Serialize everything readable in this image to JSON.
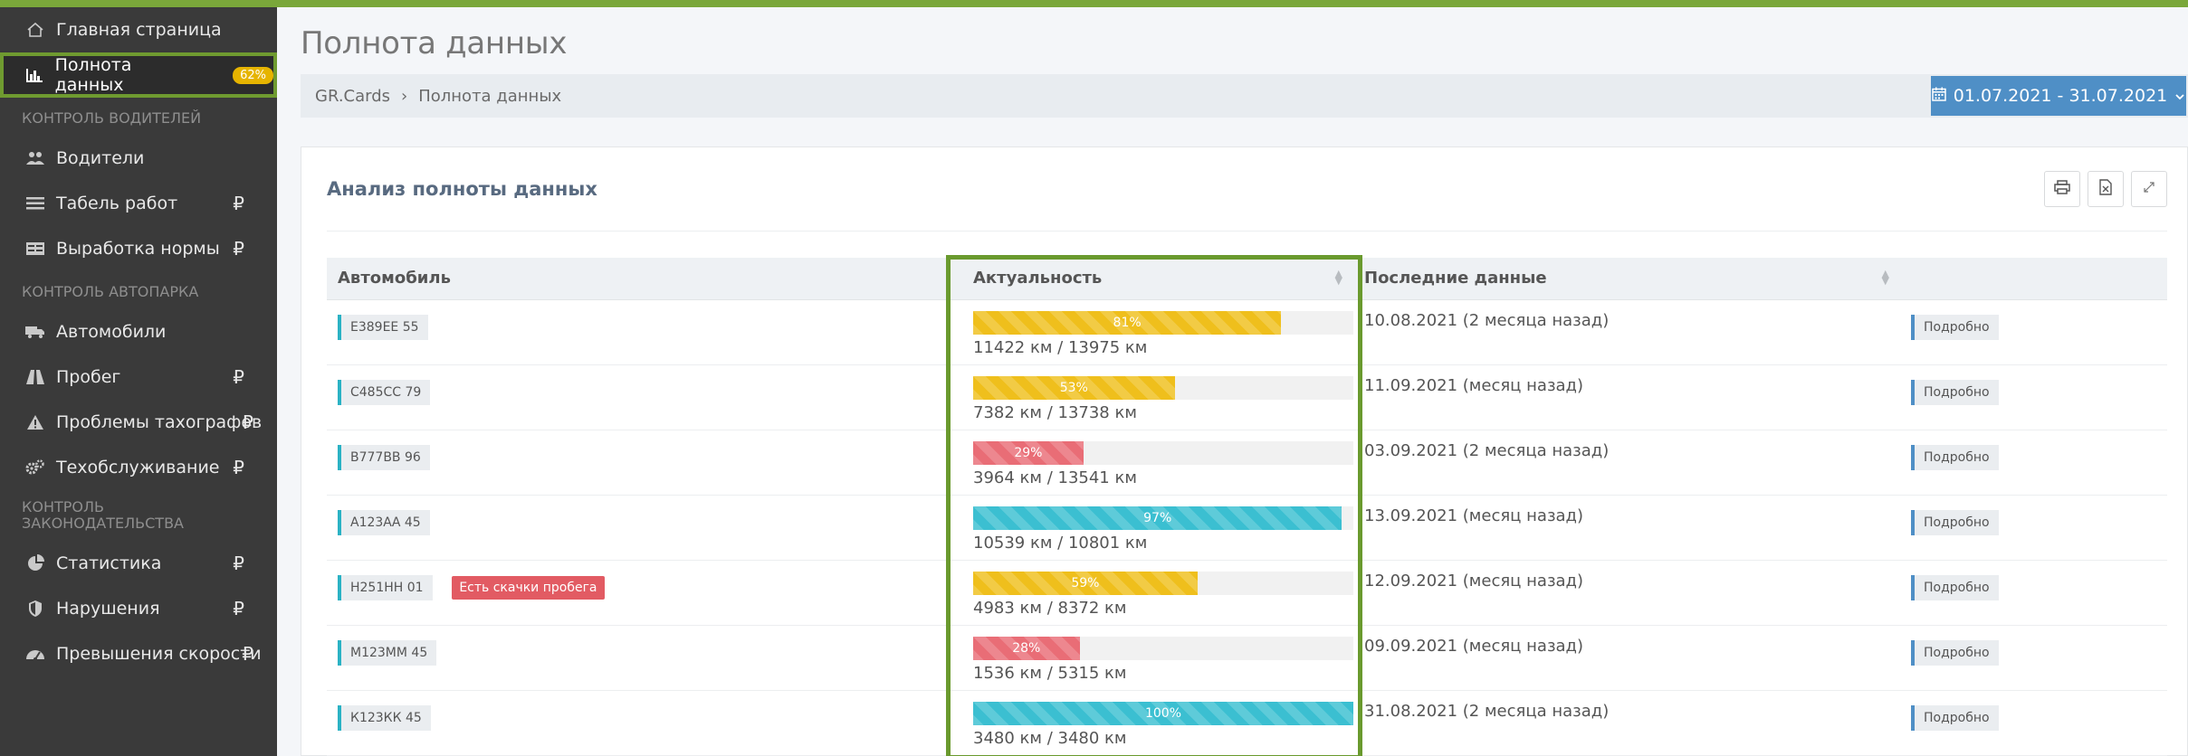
{
  "sidebar": {
    "items": [
      {
        "label": "Главная страница",
        "icon": "home-icon"
      },
      {
        "label": "Полнота данных",
        "icon": "bar-chart-icon",
        "badge": "62%"
      },
      {
        "section": "КОНТРОЛЬ ВОДИТЕЛЕЙ"
      },
      {
        "label": "Водители",
        "icon": "users-icon"
      },
      {
        "label": "Табель работ",
        "icon": "list-icon",
        "rub": "₽"
      },
      {
        "label": "Выработка нормы",
        "icon": "table-icon",
        "rub": "₽"
      },
      {
        "section": "КОНТРОЛЬ АВТОПАРКА"
      },
      {
        "label": "Автомобили",
        "icon": "truck-icon"
      },
      {
        "label": "Пробег",
        "icon": "road-icon",
        "rub": "₽"
      },
      {
        "label": "Проблемы тахографов",
        "icon": "warning-icon",
        "rub": "₽"
      },
      {
        "label": "Техобслуживание",
        "icon": "cogs-icon",
        "rub": "₽"
      },
      {
        "section": "КОНТРОЛЬ ЗАКОНОДАТЕЛЬСТВА"
      },
      {
        "label": "Статистика",
        "icon": "pie-chart-icon",
        "rub": "₽"
      },
      {
        "label": "Нарушения",
        "icon": "shield-icon",
        "rub": "₽"
      },
      {
        "label": "Превышения скорости",
        "icon": "speedometer-icon",
        "rub": "₽"
      }
    ]
  },
  "header": {
    "title": "Полнота данных",
    "breadcrumb": [
      "GR.Cards",
      "›",
      "Полнота данных"
    ],
    "date_range": "01.07.2021 - 31.07.2021"
  },
  "panel": {
    "title": "Анализ полноты данных",
    "tools": [
      "print-icon",
      "excel-icon",
      "expand-icon"
    ]
  },
  "table": {
    "headers": [
      "Автомобиль",
      "Актуальность",
      "Последние данные",
      ""
    ],
    "detail_label": "Подробно",
    "rows": [
      {
        "plate": "Е389ЕЕ 55",
        "tag": "",
        "pct_label": "81%",
        "pct": 81,
        "color": "yellow",
        "km": "11422 км / 13975 км",
        "last": "10.08.2021  (2 месяца назад)"
      },
      {
        "plate": "С485СС 79",
        "tag": "",
        "pct_label": "53%",
        "pct": 53,
        "color": "yellow",
        "km": "7382 км / 13738 км",
        "last": "11.09.2021  (месяц назад)"
      },
      {
        "plate": "В777ВВ 96",
        "tag": "",
        "pct_label": "29%",
        "pct": 29,
        "color": "red",
        "km": "3964 км / 13541 км",
        "last": "03.09.2021  (2 месяца назад)"
      },
      {
        "plate": "А123АА 45",
        "tag": "",
        "pct_label": "97%",
        "pct": 97,
        "color": "cyan",
        "km": "10539 км / 10801 км",
        "last": "13.09.2021  (месяц назад)"
      },
      {
        "plate": "Н251НН 01",
        "tag": "Есть скачки пробега",
        "pct_label": "59%",
        "pct": 59,
        "color": "yellow",
        "km": "4983 км / 8372 км",
        "last": "12.09.2021  (месяц назад)"
      },
      {
        "plate": "М123ММ 45",
        "tag": "",
        "pct_label": "28%",
        "pct": 28,
        "color": "red",
        "km": "1536 км / 5315 км",
        "last": "09.09.2021  (месяц назад)"
      },
      {
        "plate": "К123КК 45",
        "tag": "",
        "pct_label": "100%",
        "pct": 100,
        "color": "cyan",
        "km": "3480 км / 3480 км",
        "last": "31.08.2021  (2 месяца назад)"
      }
    ]
  },
  "colors": {
    "accent_green": "#6a9a2e",
    "primary_blue": "#4f8fc6",
    "sidebar_bg": "#3a3a3a",
    "badge_yellow": "#e6b400",
    "bar_yellow": "#efbf1c",
    "bar_red": "#e96d76",
    "bar_cyan": "#3bbfd1",
    "tag_red": "#e25b63"
  }
}
